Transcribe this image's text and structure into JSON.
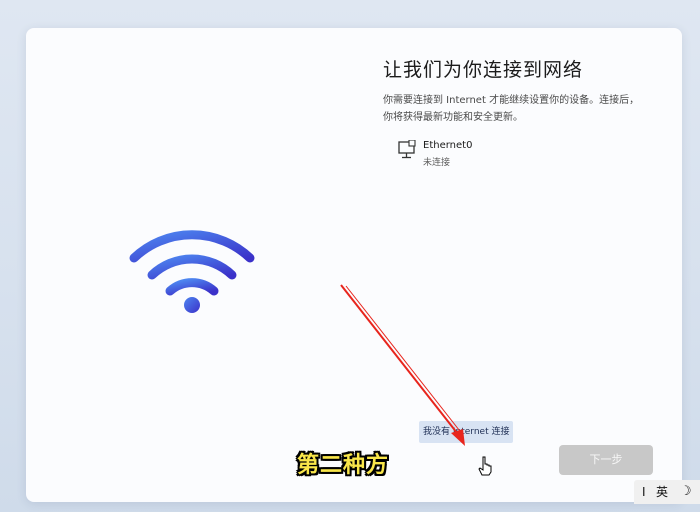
{
  "oobe": {
    "title": "让我们为你连接到网络",
    "description": "你需要连接到 Internet 才能继续设置你的设备。连接后，你将获得最新功能和安全更新。",
    "network": {
      "name": "Ethernet0",
      "status": "未连接"
    },
    "no_internet_label": "我没有 Internet 连接",
    "next_label": "下一步"
  },
  "overlay": {
    "subtitle": "第二种方",
    "arrow_color": "#e8251d"
  },
  "ime": {
    "separator": "I",
    "language": "英",
    "mode_icon": "☽"
  },
  "colors": {
    "accent": "#3f6ee0",
    "next_disabled": "#c8c8c8",
    "subtitle_fill": "#f9e64a"
  }
}
